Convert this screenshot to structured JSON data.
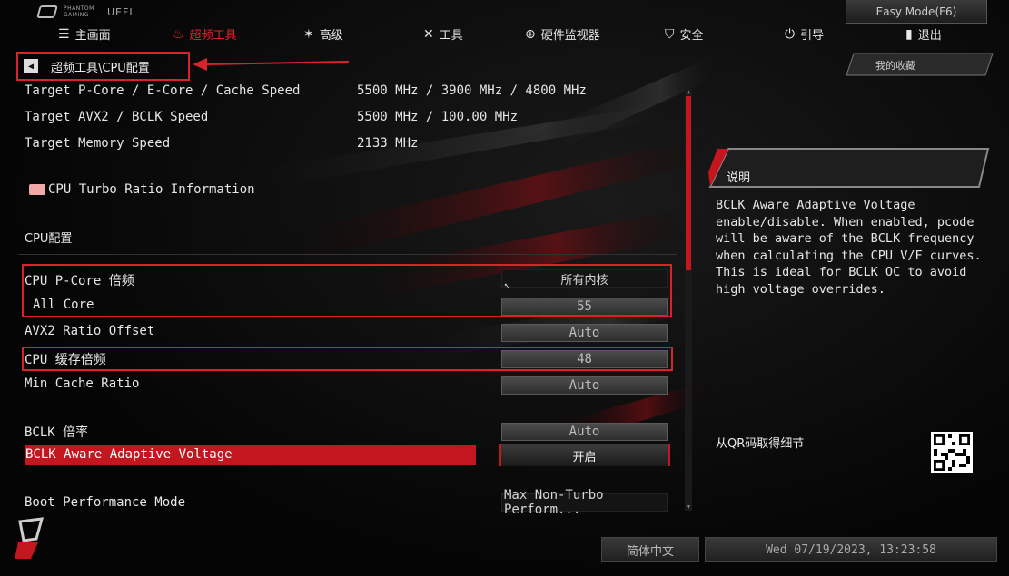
{
  "brand": {
    "line1": "PHANTOM",
    "line2": "GAMING",
    "uefi": "UEFI"
  },
  "mode_button": "Easy Mode(F6)",
  "menu": [
    {
      "label": "主画面",
      "icon": "list-icon"
    },
    {
      "label": "超频工具",
      "icon": "flame-icon",
      "active": true
    },
    {
      "label": "高级",
      "icon": "star-icon"
    },
    {
      "label": "工具",
      "icon": "tools-icon"
    },
    {
      "label": "硬件监视器",
      "icon": "crosshair-icon"
    },
    {
      "label": "安全",
      "icon": "shield-icon"
    },
    {
      "label": "引导",
      "icon": "power-icon"
    },
    {
      "label": "退出",
      "icon": "exit-icon"
    }
  ],
  "breadcrumb": "超频工具\\CPU配置",
  "favorites": "我的收藏",
  "info_rows": [
    {
      "label": "Target P-Core / E-Core / Cache Speed",
      "value": "5500 MHz / 3900 MHz / 4800 MHz"
    },
    {
      "label": "Target AVX2 / BCLK Speed",
      "value": "5500 MHz / 100.00 MHz"
    },
    {
      "label": "Target Memory Speed",
      "value": "2133 MHz"
    }
  ],
  "turbo_folder": "CPU Turbo Ratio Information",
  "section_title": "CPU配置",
  "settings": {
    "pcore_ratio": {
      "label": "CPU P-Core 倍频",
      "value": "所有内核"
    },
    "all_core": {
      "label": "All Core",
      "value": "55"
    },
    "avx2": {
      "label": "AVX2 Ratio Offset",
      "value": "Auto"
    },
    "cache_ratio": {
      "label": "CPU  缓存倍频",
      "value": "48"
    },
    "min_cache": {
      "label": "Min Cache  Ratio",
      "value": "Auto"
    },
    "bclk_ratio": {
      "label": "BCLK 倍率",
      "value": "Auto"
    },
    "bclk_adaptive": {
      "label": "BCLK Aware Adaptive Voltage",
      "value": "开启"
    },
    "boot_perf": {
      "label": "Boot Performance Mode",
      "value": "Max Non-Turbo Perform..."
    }
  },
  "description": {
    "title": "说明",
    "text": "BCLK Aware Adaptive Voltage enable/disable. When enabled, pcode will be aware of the BCLK frequency when calculating the CPU V/F curves. This is ideal for BCLK OC to avoid high voltage overrides."
  },
  "qr_label": "从QR码取得细节",
  "language": "简体中文",
  "datetime": "Wed 07/19/2023, 13:23:58",
  "colors": {
    "accent": "#d9232b",
    "selected": "#c4161e",
    "background": "#050505"
  }
}
